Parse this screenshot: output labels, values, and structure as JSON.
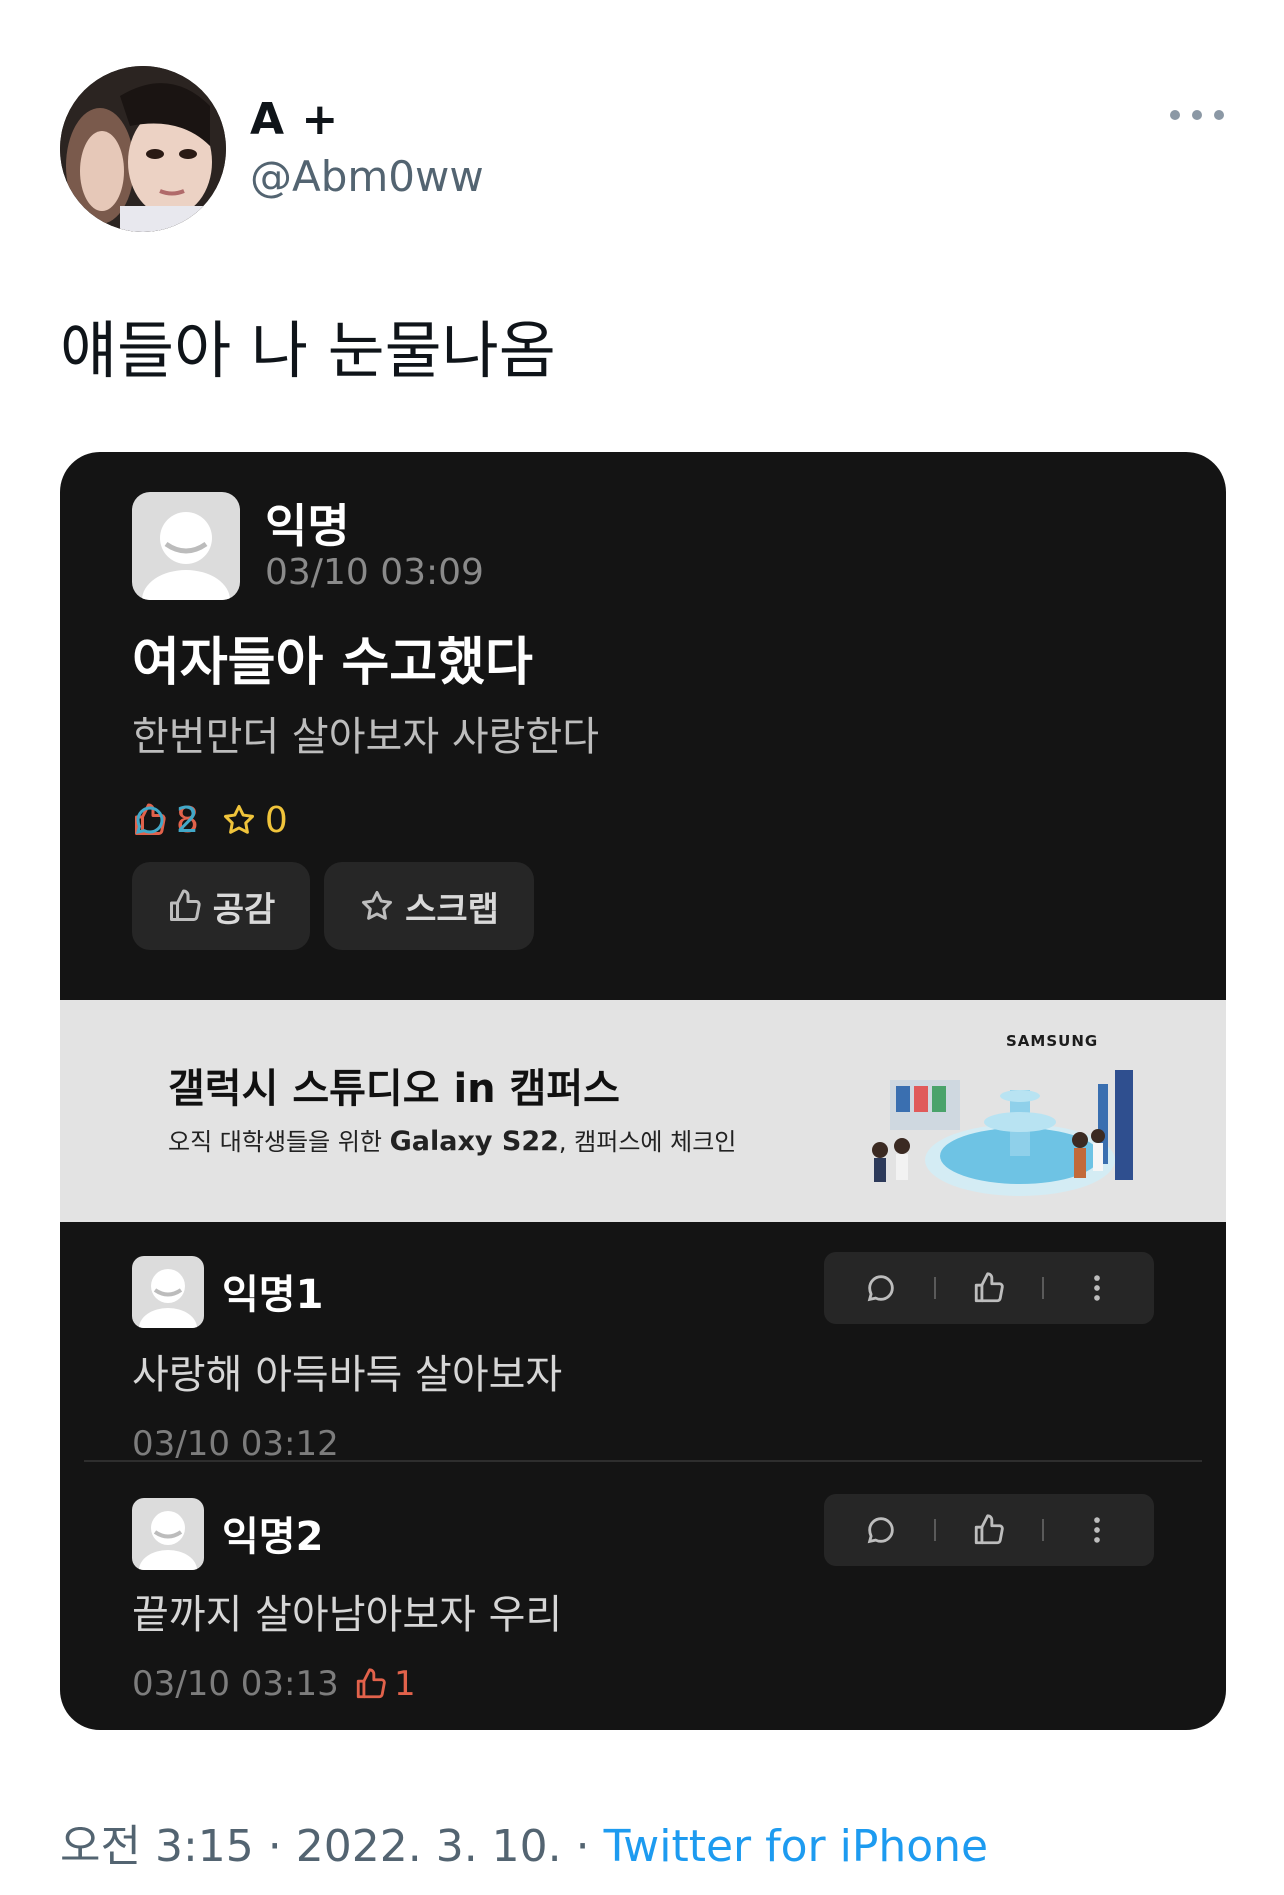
{
  "tweet": {
    "display_name": "A +",
    "handle": "@Abm0ww",
    "text": "얘들아 나 눈물나옴",
    "time": "오전 3:15",
    "separator": "·",
    "date": "2022. 3. 10.",
    "source": "Twitter for iPhone"
  },
  "post": {
    "author": "익명",
    "time": "03/10 03:09",
    "title": "여자들아 수고했다",
    "body": "한번만더 살아보자 사랑한다",
    "likes": "8",
    "comments": "2",
    "scraps": "0",
    "like_button": "공감",
    "scrap_button": "스크랩"
  },
  "ad": {
    "title": "갤럭시 스튜디오 in 캠퍼스",
    "sub_prefix": "오직 대학생들을 위한 ",
    "sub_bold": "Galaxy S22",
    "sub_suffix": ", 캠퍼스에 체크인",
    "brand": "SAMSUNG"
  },
  "comments": [
    {
      "author": "익명1",
      "text": "사랑해 아득바득 살아보자",
      "time": "03/10 03:12",
      "likes": ""
    },
    {
      "author": "익명2",
      "text": "끝까지 살아남아보자 우리",
      "time": "03/10 03:13",
      "likes": "1"
    }
  ],
  "colors": {
    "accent_blue": "#1d9bf0",
    "like_red": "#e2624b",
    "comment_cyan": "#42a8c8",
    "scrap_yellow": "#f0c43b",
    "card_bg": "#141414"
  }
}
